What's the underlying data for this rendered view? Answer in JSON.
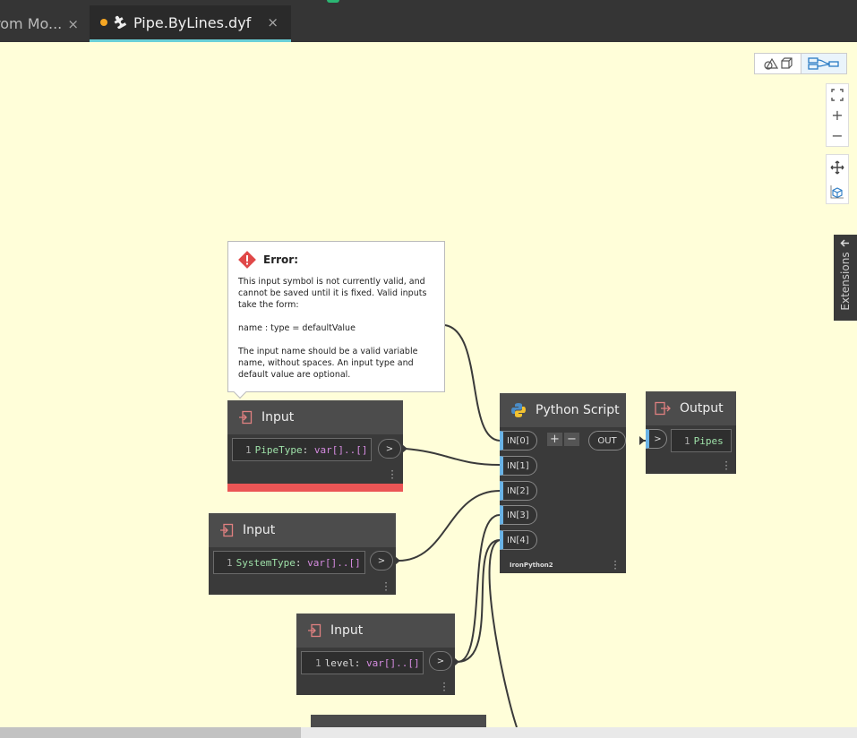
{
  "tabs": [
    {
      "label": "rom Mo...",
      "active": false
    },
    {
      "label": "Pipe.ByLines.dyf",
      "active": true,
      "dirty": true
    }
  ],
  "tab_close_symbol": "×",
  "toolbar": {
    "view_3d_icon": "geometry-view-icon",
    "view_graph_icon": "graph-view-icon",
    "zoom_fit_icon": "fit-to-screen-icon",
    "zoom_in": "+",
    "zoom_out": "−",
    "pan_icon": "pan-icon",
    "orbit_icon": "orbit-icon"
  },
  "extensions": {
    "label": "Extensions",
    "arrow": "🡐"
  },
  "error_tooltip": {
    "title": "Error:",
    "paragraph1": "This input symbol is not currently valid, and cannot be saved until it is fixed. Valid inputs take the form:",
    "paragraph2": "name : type = defaultValue",
    "paragraph3": "The input name should be a valid variable name, without spaces. An input type and default value are optional."
  },
  "input_nodes": [
    {
      "title": "Input",
      "line": "1",
      "name": "PipeType",
      "type": "var[]..[]",
      "error": true
    },
    {
      "title": "Input",
      "line": "1",
      "name": "SystemType",
      "type": "var[]..[]",
      "error": false
    },
    {
      "title": "Input",
      "line": "1",
      "name": "level",
      "type": "var[]..[]",
      "error": false
    }
  ],
  "output_button": ">",
  "python_node": {
    "title": "Python Script",
    "inputs": [
      "IN[0]",
      "IN[1]",
      "IN[2]",
      "IN[3]",
      "IN[4]"
    ],
    "plus": "+",
    "minus": "−",
    "output": "OUT",
    "engine": "IronPython2"
  },
  "output_node": {
    "title": "Output",
    "line": "1",
    "value": "Pipes"
  },
  "colors": {
    "canvas": "#fffed9",
    "node_body": "#3a3a3a",
    "node_header": "#4c4c4c",
    "error": "#eb5555",
    "port_accent": "#6ab3e6",
    "active_tab_underline": "#6ad0d8",
    "dirty_dot": "#f5a623"
  }
}
